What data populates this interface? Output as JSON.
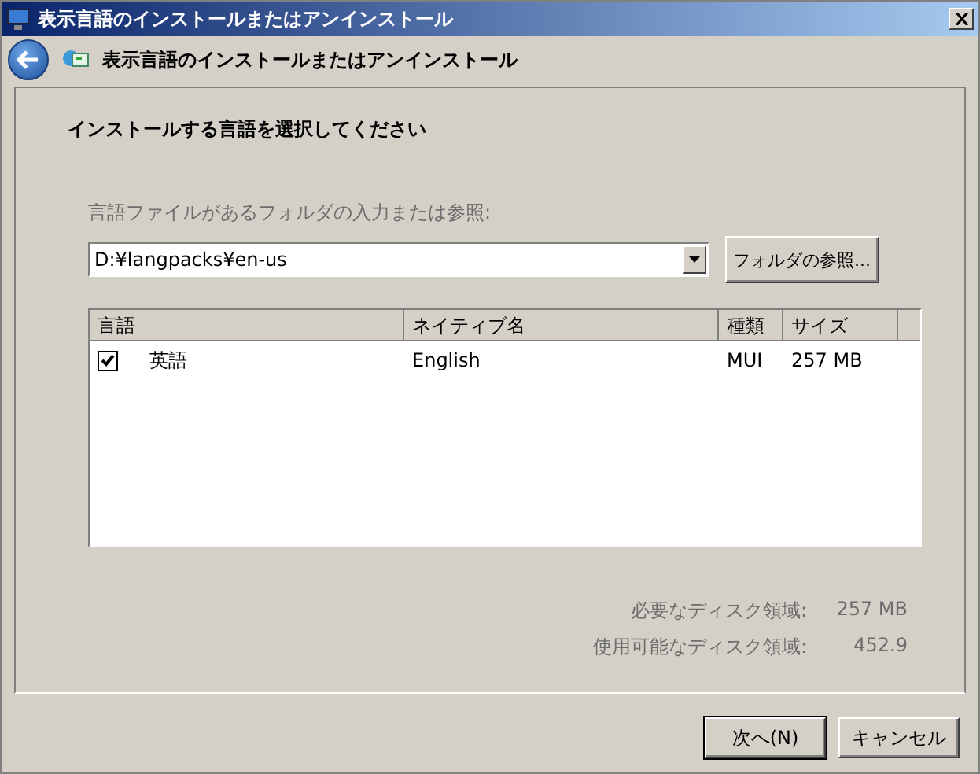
{
  "window": {
    "title": "表示言語のインストールまたはアンインストール"
  },
  "nav": {
    "title": "表示言語のインストールまたはアンインストール"
  },
  "heading": "インストールする言語を選択してください",
  "folder": {
    "label": "言語ファイルがあるフォルダの入力または参照:",
    "value": "D:¥langpacks¥en-us",
    "browse": "フォルダの参照..."
  },
  "table": {
    "columns": [
      "言語",
      "ネイティブ名",
      "種類",
      "サイズ"
    ],
    "rows": [
      {
        "checked": true,
        "cells": [
          "英語",
          "English",
          "MUI",
          "257 MB"
        ]
      }
    ]
  },
  "disk": [
    {
      "label": "必要なディスク領域:",
      "value": "257 MB"
    },
    {
      "label": "使用可能なディスク領域:",
      "value": "452.9"
    }
  ],
  "buttons": [
    "次へ(N)",
    "キャンセル"
  ]
}
